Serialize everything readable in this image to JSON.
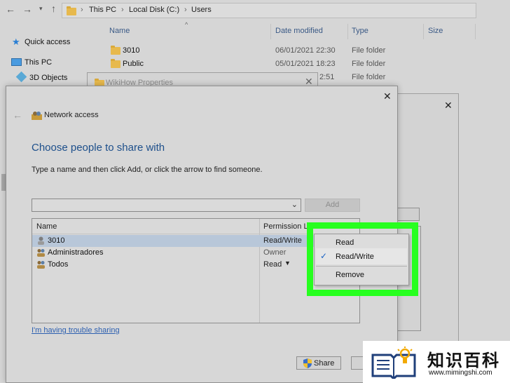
{
  "explorer": {
    "breadcrumb": [
      "This PC",
      "Local Disk (C:)",
      "Users"
    ],
    "columns": {
      "name": "Name",
      "date_modified": "Date modified",
      "type": "Type",
      "size": "Size"
    },
    "nav": {
      "quick_access": "Quick access",
      "this_pc": "This PC",
      "objects_3d": "3D Objects"
    },
    "files": [
      {
        "name": "3010",
        "date": "06/01/2021 22:30",
        "type": "File folder"
      },
      {
        "name": "Public",
        "date": "05/01/2021 18:23",
        "type": "File folder"
      },
      {
        "name": "",
        "date": "2:51",
        "type": "File folder"
      }
    ]
  },
  "bg_dialog": {
    "title": "WikiHow Properties"
  },
  "dialog": {
    "title": "Network access",
    "heading": "Choose people to share with",
    "instruction": "Type a name and then click Add, or click the arrow to find someone.",
    "add_label": "Add",
    "list_headers": {
      "name": "Name",
      "permission": "Permission L"
    },
    "users": [
      {
        "name": "3010",
        "permission": "Read/Write"
      },
      {
        "name": "Administradores",
        "permission": "Owner"
      },
      {
        "name": "Todos",
        "permission": "Read"
      }
    ],
    "trouble_link": "I'm having trouble sharing",
    "share_label": "Share",
    "cancel_label": "C"
  },
  "menu": {
    "items": [
      "Read",
      "Read/Write",
      "Remove"
    ],
    "checked": "Read/Write"
  },
  "watermark": {
    "title": "知识百科",
    "url": "www.mimingshi.com"
  },
  "colors": {
    "highlight": "#27ff1f",
    "heading": "#1d4f8b",
    "selected_row": "#b8c7d9"
  }
}
